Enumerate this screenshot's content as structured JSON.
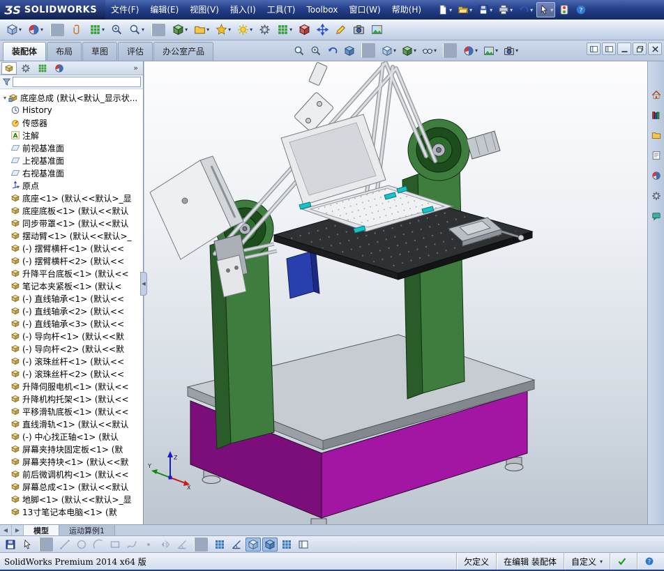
{
  "window": {
    "logo_mark": "ƷS",
    "logo_text": "SOLIDWORKS"
  },
  "titlebar": {
    "menus": [
      {
        "name": "menu-file",
        "label": "文件(F)"
      },
      {
        "name": "menu-edit",
        "label": "编辑(E)"
      },
      {
        "name": "menu-view",
        "label": "视图(V)"
      },
      {
        "name": "menu-insert",
        "label": "插入(I)"
      },
      {
        "name": "menu-tools",
        "label": "工具(T)"
      },
      {
        "name": "menu-toolbox",
        "label": "Toolbox"
      },
      {
        "name": "menu-window",
        "label": "窗口(W)"
      },
      {
        "name": "menu-help",
        "label": "帮助(H)"
      }
    ],
    "icons": [
      {
        "name": "new-document-icon",
        "icon": "page",
        "dd": true
      },
      {
        "name": "open-icon",
        "icon": "folder-open",
        "dd": true
      },
      {
        "name": "save-icon",
        "icon": "floppy",
        "dd": true
      },
      {
        "name": "print-icon",
        "icon": "printer",
        "dd": true
      },
      {
        "name": "undo-icon",
        "icon": "undo",
        "dd": true
      },
      {
        "name": "select-cursor-icon",
        "icon": "cursor",
        "dd": true,
        "active": true
      },
      {
        "name": "rebuild-icon",
        "icon": "rebuild"
      },
      {
        "name": "help-icon",
        "icon": "help"
      }
    ]
  },
  "toolbar2": {
    "icons": [
      {
        "name": "view-settings-icon",
        "icon": "viewcube",
        "dd": true
      },
      {
        "name": "appearance-icon",
        "icon": "ball",
        "dd": true
      },
      {
        "sep": true
      },
      {
        "name": "mate-icon",
        "icon": "clip"
      },
      {
        "name": "component-pattern-icon",
        "icon": "grid",
        "dd": true
      },
      {
        "name": "zoom-in-icon",
        "icon": "magnifier-plus"
      },
      {
        "name": "zoom-tools-icon",
        "icon": "magnifier",
        "dd": true
      },
      {
        "sep": true
      },
      {
        "name": "insert-component-icon",
        "icon": "cube-green",
        "dd": true
      },
      {
        "name": "open-part-icon",
        "icon": "folder",
        "dd": true
      },
      {
        "name": "smart-fasteners-icon",
        "icon": "star",
        "dd": true
      },
      {
        "name": "assembly-appearance-icon",
        "icon": "sun",
        "dd": true
      },
      {
        "name": "motion-icon",
        "icon": "gear"
      },
      {
        "name": "linear-pattern-icon",
        "icon": "grid",
        "dd": true
      },
      {
        "name": "interference-detection-icon",
        "icon": "cube-red"
      },
      {
        "name": "move-component-icon",
        "icon": "move"
      },
      {
        "name": "annotations-icon",
        "icon": "pencil"
      },
      {
        "name": "snapshot-icon",
        "icon": "camera"
      },
      {
        "name": "render-icon",
        "icon": "scene"
      }
    ]
  },
  "command_tabs": {
    "tabs": [
      {
        "name": "tab-assembly",
        "label": "装配体",
        "active": true
      },
      {
        "name": "tab-layout",
        "label": "布局"
      },
      {
        "name": "tab-sketch",
        "label": "草图"
      },
      {
        "name": "tab-evaluate",
        "label": "评估"
      },
      {
        "name": "tab-office-products",
        "label": "办公室产品"
      }
    ]
  },
  "headsup": {
    "icons": [
      {
        "name": "zoom-to-fit-icon",
        "icon": "magnifier"
      },
      {
        "name": "zoom-to-area-icon",
        "icon": "magnifier-plus"
      },
      {
        "name": "previous-view-icon",
        "icon": "undo"
      },
      {
        "name": "section-view-icon",
        "icon": "cube-blue"
      },
      {
        "sep": true
      },
      {
        "name": "view-orientation-icon",
        "icon": "viewcube",
        "dd": true
      },
      {
        "name": "display-style-icon",
        "icon": "cube-green",
        "dd": true
      },
      {
        "name": "hide-show-items-icon",
        "icon": "glasses",
        "dd": true
      },
      {
        "sep": true
      },
      {
        "name": "edit-appearance-icon",
        "icon": "ball",
        "dd": true
      },
      {
        "name": "apply-scene-icon",
        "icon": "scene",
        "dd": true
      },
      {
        "name": "view-settings-2-icon",
        "icon": "camera",
        "dd": true
      }
    ]
  },
  "doc_controls": {
    "icons": [
      {
        "name": "collapse-pane-icon",
        "icon": "pane"
      },
      {
        "name": "collapse-pane-2-icon",
        "icon": "pane"
      },
      {
        "name": "minimize-window-icon",
        "icon": "min"
      },
      {
        "name": "restore-window-icon",
        "icon": "restore"
      },
      {
        "name": "close-window-icon",
        "icon": "close"
      }
    ]
  },
  "left_panel": {
    "overflow": "»",
    "splitter_glyph": "◀",
    "filter": {
      "placeholder": ""
    },
    "pane_tabs": [
      {
        "name": "featuremanager-tab-icon",
        "icon": "component",
        "active": true
      },
      {
        "name": "propertymanager-tab-icon",
        "icon": "gear"
      },
      {
        "name": "configurationmanager-tab-icon",
        "icon": "grid"
      },
      {
        "name": "displaymanager-tab-icon",
        "icon": "ball"
      }
    ]
  },
  "feature_tree": {
    "root": {
      "expander": "▾",
      "label": "底座总成",
      "suffix": "(默认<默认_显示状..."
    },
    "items": [
      {
        "icon": "history",
        "label": "History",
        "suffix": ""
      },
      {
        "icon": "sensor",
        "label": "传感器",
        "suffix": ""
      },
      {
        "icon": "annotation",
        "label": "注解",
        "suffix": ""
      },
      {
        "icon": "plane",
        "label": "前视基准面",
        "suffix": ""
      },
      {
        "icon": "plane",
        "label": "上视基准面",
        "suffix": ""
      },
      {
        "icon": "plane",
        "label": "右视基准面",
        "suffix": ""
      },
      {
        "icon": "origin",
        "label": "原点",
        "suffix": ""
      },
      {
        "icon": "component",
        "label": "底座<1>",
        "suffix": "(默认<<默认>_显"
      },
      {
        "icon": "component",
        "label": "底座底板<1>",
        "suffix": "(默认<<默认"
      },
      {
        "icon": "component",
        "label": "同步带罩<1>",
        "suffix": "(默认<<默认"
      },
      {
        "icon": "component",
        "label": "摆动臂<1>",
        "suffix": "(默认<<默认>_"
      },
      {
        "icon": "component",
        "label": "(-) 摆臂横杆<1>",
        "suffix": "(默认<<"
      },
      {
        "icon": "component",
        "label": "(-) 摆臂横杆<2>",
        "suffix": "(默认<<"
      },
      {
        "icon": "component",
        "label": "升降平台底板<1>",
        "suffix": "(默认<<"
      },
      {
        "icon": "component",
        "label": "笔记本夹紧板<1>",
        "suffix": "(默认<"
      },
      {
        "icon": "component",
        "label": "(-) 直线轴承<1>",
        "suffix": "(默认<<"
      },
      {
        "icon": "component",
        "label": "(-) 直线轴承<2>",
        "suffix": "(默认<<"
      },
      {
        "icon": "component",
        "label": "(-) 直线轴承<3>",
        "suffix": "(默认<<"
      },
      {
        "icon": "component",
        "label": "(-) 导向杆<1>",
        "suffix": "(默认<<默"
      },
      {
        "icon": "component",
        "label": "(-) 导向杆<2>",
        "suffix": "(默认<<默"
      },
      {
        "icon": "component",
        "label": "(-) 滚珠丝杆<1>",
        "suffix": "(默认<<"
      },
      {
        "icon": "component",
        "label": "(-) 滚珠丝杆<2>",
        "suffix": "(默认<<"
      },
      {
        "icon": "component",
        "label": "升降伺服电机<1>",
        "suffix": "(默认<<"
      },
      {
        "icon": "component",
        "label": "升降机构托架<1>",
        "suffix": "(默认<<"
      },
      {
        "icon": "component",
        "label": "平移滑轨底板<1>",
        "suffix": "(默认<<"
      },
      {
        "icon": "component",
        "label": "直线滑轨<1>",
        "suffix": "(默认<<默认"
      },
      {
        "icon": "component",
        "label": "(-) 中心找正轴<1>",
        "suffix": "(默认"
      },
      {
        "icon": "component",
        "label": "屏幕夹持块固定板<1>",
        "suffix": "(默"
      },
      {
        "icon": "component",
        "label": "屏幕夹持块<1>",
        "suffix": "(默认<<默"
      },
      {
        "icon": "component",
        "label": "前后微调机构<1>",
        "suffix": "(默认<<"
      },
      {
        "icon": "component",
        "label": "屏幕总成<1>",
        "suffix": "(默认<<默认"
      },
      {
        "icon": "component",
        "label": "地脚<1>",
        "suffix": "(默认<<默认>_显"
      },
      {
        "icon": "component",
        "label": "13寸笔记本电脑<1>",
        "suffix": "(默"
      }
    ]
  },
  "taskpane": {
    "icons": [
      {
        "name": "solidworks-resources-icon",
        "icon": "house"
      },
      {
        "name": "design-library-icon",
        "icon": "books"
      },
      {
        "name": "file-explorer-icon",
        "icon": "folder"
      },
      {
        "name": "view-palette-icon",
        "icon": "sheet"
      },
      {
        "name": "appearances-scenes-icon",
        "icon": "ball"
      },
      {
        "name": "custom-properties-icon",
        "icon": "gear"
      },
      {
        "name": "solidworks-forum-icon",
        "icon": "forum"
      }
    ]
  },
  "bottom_tabs": {
    "nav": [
      {
        "name": "tab-scroll-left",
        "glyph": "◀"
      },
      {
        "name": "tab-scroll-right",
        "glyph": "▶"
      }
    ],
    "tabs": [
      {
        "name": "tab-model",
        "label": "模型",
        "active": true
      },
      {
        "name": "tab-motion-study-1",
        "label": "运动算例1"
      }
    ]
  },
  "bottom_toolbar": {
    "icons": [
      {
        "name": "save-icon",
        "icon": "floppy"
      },
      {
        "name": "select-icon",
        "icon": "cursor"
      },
      {
        "sep": true
      },
      {
        "name": "line-tool-icon",
        "icon": "line",
        "disabled": true
      },
      {
        "name": "circle-tool-icon",
        "icon": "circle-o",
        "disabled": true
      },
      {
        "name": "arc-tool-icon",
        "icon": "arc",
        "disabled": true
      },
      {
        "name": "rectangle-tool-icon",
        "icon": "rect-o",
        "disabled": true
      },
      {
        "name": "spline-tool-icon",
        "icon": "spline",
        "disabled": true
      },
      {
        "name": "point-tool-icon",
        "icon": "point",
        "disabled": true
      },
      {
        "name": "mirror-tool-icon",
        "icon": "mirror",
        "disabled": true
      },
      {
        "name": "trim-tool-icon",
        "icon": "angle",
        "disabled": true
      },
      {
        "sep": true
      },
      {
        "name": "grid-snap-icon",
        "icon": "grid-blue"
      },
      {
        "name": "snap-angle-icon",
        "icon": "angle"
      },
      {
        "name": "isometric-view-icon",
        "icon": "viewcube",
        "active": true
      },
      {
        "name": "shaded-view-icon",
        "icon": "cube-blue",
        "active": true
      },
      {
        "name": "draft-grid-icon",
        "icon": "grid-blue"
      },
      {
        "name": "split-view-icon",
        "icon": "pane"
      }
    ]
  },
  "status_bar": {
    "left": "SolidWorks Premium 2014 x64 版",
    "cells": [
      {
        "name": "status-under-defined",
        "label": "欠定义"
      },
      {
        "name": "status-editing-assembly",
        "label": "在编辑 装配体"
      },
      {
        "name": "status-custom",
        "label": "自定义",
        "dd": true
      },
      {
        "name": "status-ok-icon",
        "icon": "check"
      },
      {
        "name": "status-help-icon",
        "icon": "help"
      }
    ]
  },
  "viewport": {
    "triad": {
      "x": "X",
      "y": "Y",
      "z": "Z"
    },
    "model_colors": {
      "base": "#a316a3",
      "base_shadow": "#7c0e7c",
      "plate": "#c6ccd2",
      "column": "#3f7d3f",
      "hub": "#1d4d1d",
      "tray": "#2e3133",
      "laptop": "#e8eaec",
      "screen_box": "#edeff0",
      "clips": "#17c2c8",
      "pendant": "#2a3fae"
    }
  }
}
